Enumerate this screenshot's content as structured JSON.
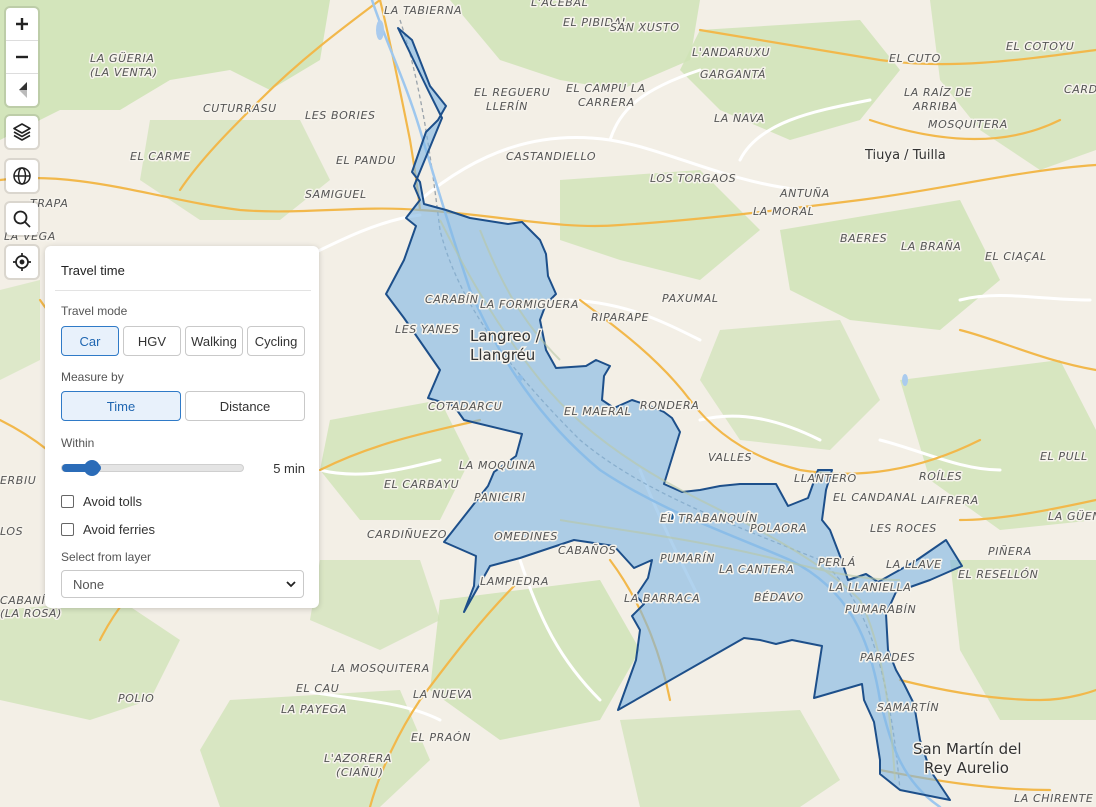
{
  "map": {
    "origin_marker_color": "#1a5a96",
    "isochrone_fill": "#7fb6e3",
    "isochrone_stroke": "#1d4f8a",
    "towns": [
      {
        "name": "Langreo /",
        "sub": "Llangréu"
      },
      {
        "name": "Tiuya / Tuilla"
      },
      {
        "name": "San Martín del",
        "sub": "Rey Aurelio"
      }
    ],
    "places": [
      "LA TABIERNA",
      "L'ACEBAL",
      "EL PIBIDAL",
      "SAN XUSTO",
      "L'ANDARUXU",
      "EL CUTO",
      "EL COTOYU",
      "LA GÜERIA",
      "(LA VENTA)",
      "CUTURRASU",
      "LES BORIES",
      "EL REGUERU",
      "LLERÍN",
      "EL CAMPU LA",
      "CARRERA",
      "GARGANTÁ",
      "LA RAÍZ DE",
      "ARRIBA",
      "CARDA",
      "LA NAVA",
      "MOSQUITERA",
      "EL CARME",
      "EL PANDU",
      "CASTANDIELLO",
      "SAMIGUEL",
      "LOS TORGAOS",
      "ANTUÑA",
      "LA MORAL",
      "TRAPA",
      "LA VEGA",
      "BAERES",
      "LA BRAÑA",
      "EL CIAÇAL",
      "CARABÍN",
      "LA FORMIGUERA",
      "PAXUMAL",
      "RIPARAPE",
      "LES YANES",
      "COTADARCU",
      "EL MAERAL",
      "RONDERA",
      "VALLES",
      "LA MOQUINA",
      "EL CARBAYU",
      "PANICIRI",
      "LLANTERO",
      "EL CANDANAL",
      "ROÍLES",
      "LAIFRERA",
      "EL PULL",
      "EL TRABANQUÍN",
      "POLAORA",
      "LES ROCES",
      "LA GÜEN",
      "CARDIÑUEZO",
      "OMEDINES",
      "CABAÑOS",
      "PUMARÍN",
      "PERLÁ",
      "LA LLAVE",
      "PIÑERA",
      "EL RESELLÓN",
      "LA CANTERA",
      "LA LLANIELLA",
      "LAMPIEDRA",
      "LA BARRACA",
      "BÉDAVO",
      "PUMARABÍN",
      "PARADES",
      "LA MOSQUITERA",
      "EL CAU",
      "POLIO",
      "LA NUEVA",
      "LA PAYEGA",
      "SAMARTÍN",
      "L'AZORERA",
      "(CIAÑU)",
      "EL PRAÓN",
      "LA CHIRENTE",
      "CABANÍN",
      "(LA ROSA)",
      "ERBIU",
      "LOS"
    ]
  },
  "controls": {
    "zoom_in": "zoom-in",
    "zoom_out": "zoom-out",
    "compass": "compass",
    "layers": "layers",
    "globe": "globe",
    "search": "search",
    "locate": "locate"
  },
  "panel": {
    "title": "Travel time",
    "travel_mode_label": "Travel mode",
    "modes": [
      "Car",
      "HGV",
      "Walking",
      "Cycling"
    ],
    "selected_mode": "Car",
    "measure_label": "Measure by",
    "measures": [
      "Time",
      "Distance"
    ],
    "selected_measure": "Time",
    "within_label": "Within",
    "within_value": "5 min",
    "within_fraction": 0.17,
    "avoid_tolls_label": "Avoid tolls",
    "avoid_tolls": false,
    "avoid_ferries_label": "Avoid ferries",
    "avoid_ferries": false,
    "select_layer_label": "Select from layer",
    "select_layer_value": "None"
  }
}
